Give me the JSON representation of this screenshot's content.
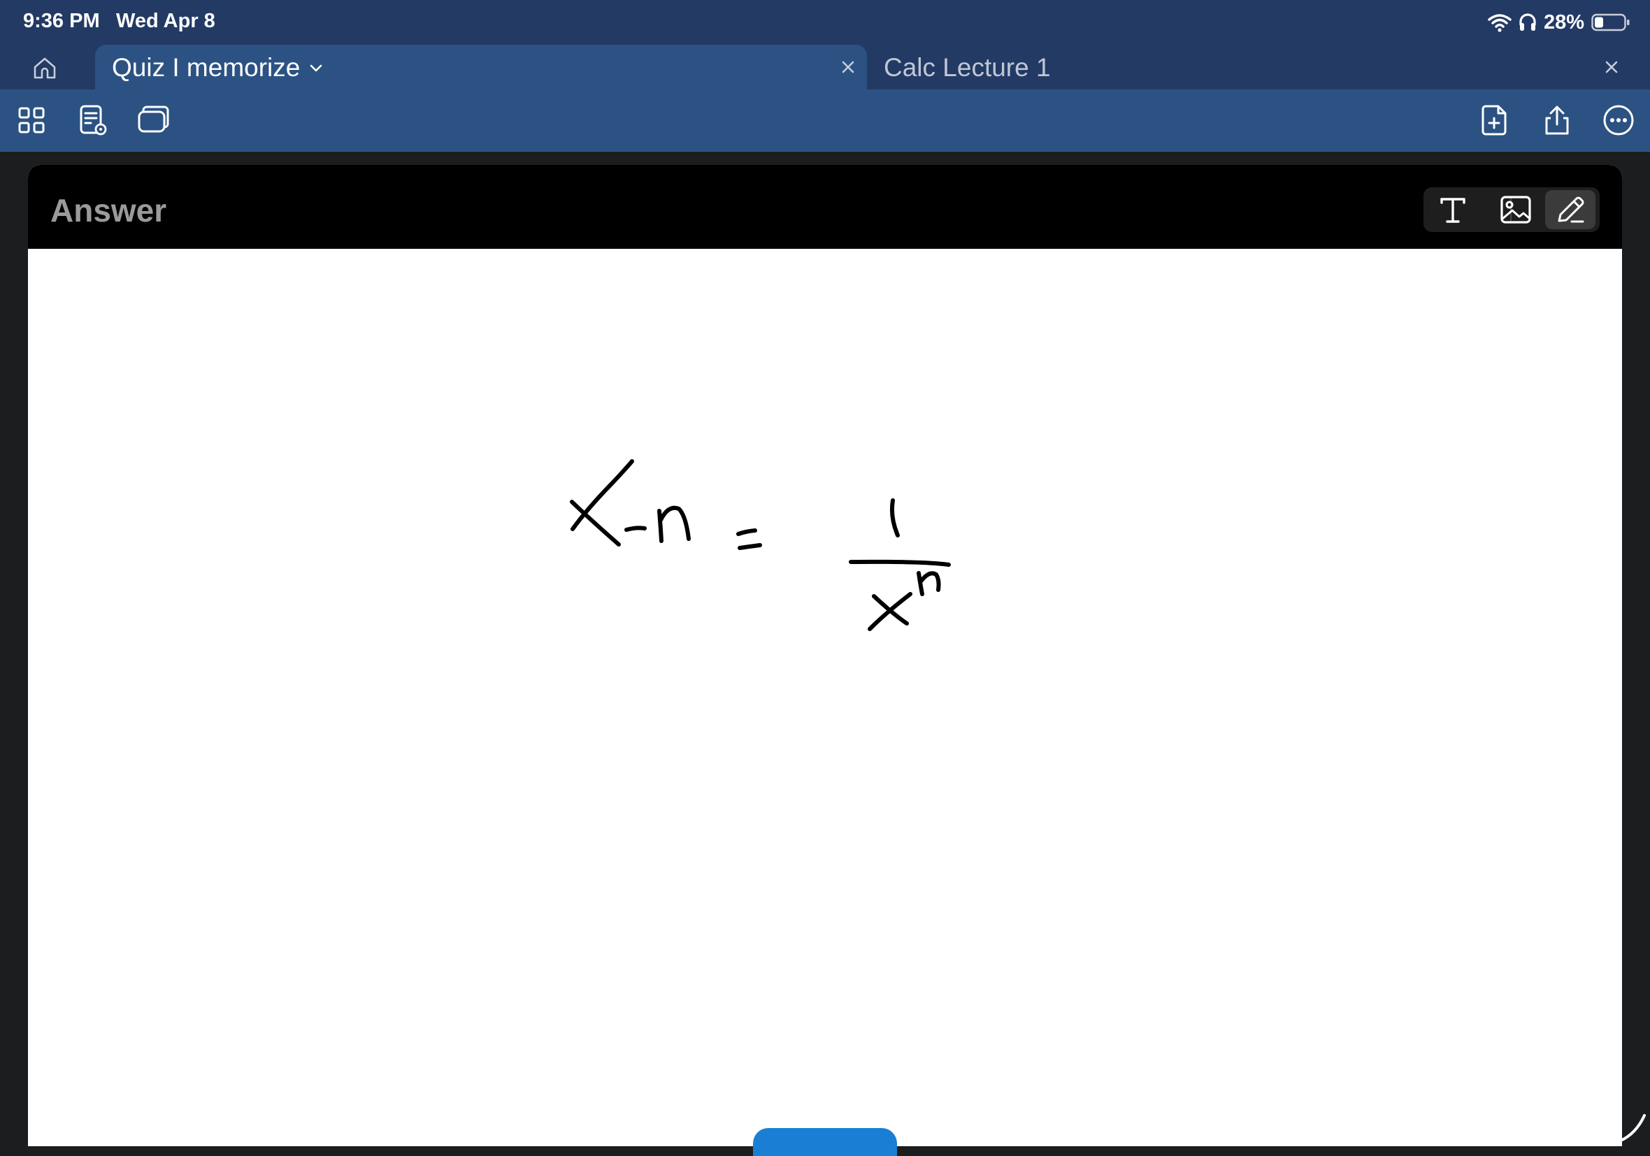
{
  "status_bar": {
    "time": "9:36 PM",
    "date": "Wed Apr 8",
    "battery": "28%",
    "icons": [
      "wifi-icon",
      "headphones-icon",
      "battery-icon"
    ]
  },
  "tabs": [
    {
      "label": "Quiz I memorize",
      "active": true,
      "has_dropdown": true
    },
    {
      "label": "Calc Lecture 1",
      "active": false
    }
  ],
  "toolbar": {
    "left_icons": [
      "grid-icon",
      "page-preview-icon",
      "copy-cards-icon"
    ],
    "right_icons": [
      "add-page-icon",
      "share-icon",
      "more-icon"
    ]
  },
  "card": {
    "title": "Answer",
    "modes": [
      {
        "name": "text-mode-icon",
        "active": false
      },
      {
        "name": "image-mode-icon",
        "active": false
      },
      {
        "name": "pen-mode-icon",
        "active": true
      }
    ]
  },
  "colors": {
    "status_bg": "#233a64",
    "toolbar_bg": "#2b5282",
    "card_header_bg": "#000000",
    "accent_button": "#1a7fd4"
  }
}
